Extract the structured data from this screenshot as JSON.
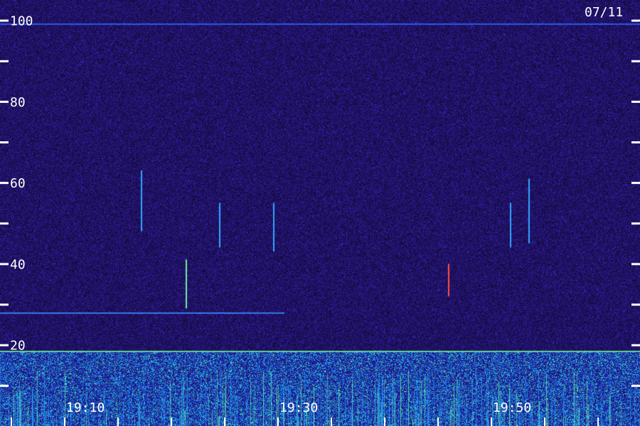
{
  "chart_data": {
    "type": "heatmap",
    "date_label": "07/11",
    "y_ticks_labeled": [
      "100",
      "80",
      "60",
      "40",
      "20"
    ],
    "y_tick_values": [
      100,
      80,
      60,
      40,
      20
    ],
    "y_minor_tick_values": [
      90,
      70,
      50,
      30,
      10
    ],
    "x_tick_labels": [
      "19:10",
      "19:30",
      "19:50"
    ],
    "ylim": [
      0,
      105
    ],
    "xlim": [
      "19:02",
      "19:62"
    ],
    "horizontal_lines": [
      {
        "value": 99.3,
        "color": "#2f64ff"
      },
      {
        "value": 28.0,
        "color": "#3a8cff"
      },
      {
        "value": 18.5,
        "color": "#6ef0a0"
      }
    ],
    "streaks": [
      {
        "time": "19:15.2",
        "from": 48,
        "to": 63,
        "color": "#2fa8ff"
      },
      {
        "time": "19:19.4",
        "from": 29,
        "to": 41,
        "color": "#6ef0a0"
      },
      {
        "time": "19:22.5",
        "from": 44,
        "to": 55,
        "color": "#2fa8ff"
      },
      {
        "time": "19:27.6",
        "from": 43,
        "to": 55,
        "color": "#2fa8ff"
      },
      {
        "time": "19:44.0",
        "from": 32,
        "to": 40,
        "color": "#ff5040"
      },
      {
        "time": "19:49.8",
        "from": 44,
        "to": 55,
        "color": "#2fa8ff"
      },
      {
        "time": "19:51.5",
        "from": 45,
        "to": 61,
        "color": "#2fa8ff"
      }
    ],
    "colors": {
      "background": "#2a1480",
      "noise_dark": "#0a0530",
      "noise_light": "#4a3aa0",
      "low_band": "#1f7dff",
      "low_band_hot": "#5ff2b0",
      "axis": "#ffffff"
    }
  }
}
